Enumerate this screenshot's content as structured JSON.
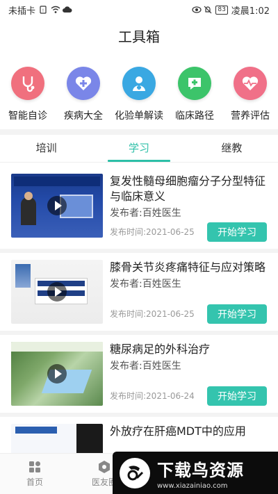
{
  "status": {
    "carrier": "未插卡",
    "battery": "83",
    "time": "凌晨1:02"
  },
  "title": "工具箱",
  "tools": [
    {
      "label": "智能自诊",
      "icon": "stethoscope-icon",
      "color": "#f0707e"
    },
    {
      "label": "疾病大全",
      "icon": "heart-plus-icon",
      "color": "#7a86e8"
    },
    {
      "label": "化验单解读",
      "icon": "doctor-icon",
      "color": "#3aa8e2"
    },
    {
      "label": "临床路径",
      "icon": "chat-plus-icon",
      "color": "#3cc46a"
    },
    {
      "label": "营养评估",
      "icon": "heartbeat-icon",
      "color": "#f07088"
    }
  ],
  "tabs": [
    "培训",
    "学习",
    "继教"
  ],
  "active_tab": "学习",
  "courses": [
    {
      "title": "复发性髓母细胞瘤分子分型特征与临床意义",
      "publisher": "发布者:百姓医生",
      "date": "发布时间:2021-06-25",
      "button": "开始学习"
    },
    {
      "title": "膝骨关节炎疼痛特征与应对策略",
      "publisher": "发布者:百姓医生",
      "date": "发布时间:2021-06-25",
      "button": "开始学习"
    },
    {
      "title": "糖尿病足的外科治疗",
      "publisher": "发布者:百姓医生",
      "date": "发布时间:2021-06-24",
      "button": "开始学习"
    },
    {
      "title": "外放疗在肝癌MDT中的应用",
      "publisher": "",
      "date": "",
      "button": ""
    }
  ],
  "nav": [
    {
      "label": "首页"
    },
    {
      "label": "医友圈"
    }
  ],
  "watermark": {
    "brand": "下载鸟资源",
    "url": "www.xiazainiao.com"
  },
  "colors": {
    "accent": "#2cbfa7",
    "button": "#34c4ae"
  }
}
